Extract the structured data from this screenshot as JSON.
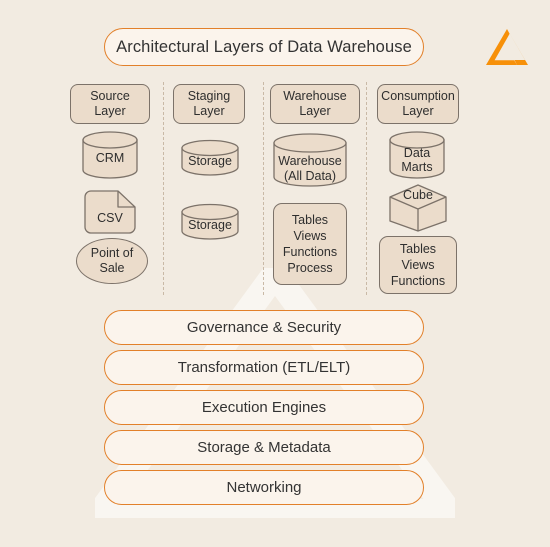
{
  "title": "Architectural Layers of Data Warehouse",
  "logo": {
    "icon": "triangle-logo-icon",
    "color": "#F79009"
  },
  "theme": {
    "background": "#F2EBE1",
    "accent": "#E2802A",
    "node_fill": "#EBDCCB",
    "node_stroke": "#7C7269",
    "pill_fill": "#FBF4EC",
    "text": "#2E2E2E"
  },
  "columns": [
    {
      "header": "Source\nLayer",
      "header_line1": "Source",
      "header_line2": "Layer",
      "nodes": [
        {
          "shape": "cylinder",
          "label": "CRM"
        },
        {
          "shape": "document",
          "label": "CSV"
        },
        {
          "shape": "ellipse",
          "label_line1": "Point of",
          "label_line2": "Sale"
        }
      ]
    },
    {
      "header_line1": "Staging",
      "header_line2": "Layer",
      "nodes": [
        {
          "shape": "cylinder",
          "label": "Storage"
        },
        {
          "shape": "cylinder",
          "label": "Storage"
        }
      ]
    },
    {
      "header_line1": "Warehouse",
      "header_line2": "Layer",
      "nodes": [
        {
          "shape": "cylinder",
          "label_line1": "Warehouse",
          "label_line2": "(All Data)"
        },
        {
          "shape": "box",
          "lines": [
            "Tables",
            "Views",
            "Functions",
            "Process"
          ]
        }
      ]
    },
    {
      "header_line1": "Consumption",
      "header_line2": "Layer",
      "nodes": [
        {
          "shape": "cylinder",
          "label_line1": "Data",
          "label_line2": "Marts"
        },
        {
          "shape": "cube",
          "label": "Cube"
        },
        {
          "shape": "box",
          "lines": [
            "Tables",
            "Views",
            "Functions"
          ]
        }
      ]
    }
  ],
  "cross_cutting_layers": [
    "Governance & Security",
    "Transformation (ETL/ELT)",
    "Execution Engines",
    "Storage & Metadata",
    "Networking"
  ]
}
